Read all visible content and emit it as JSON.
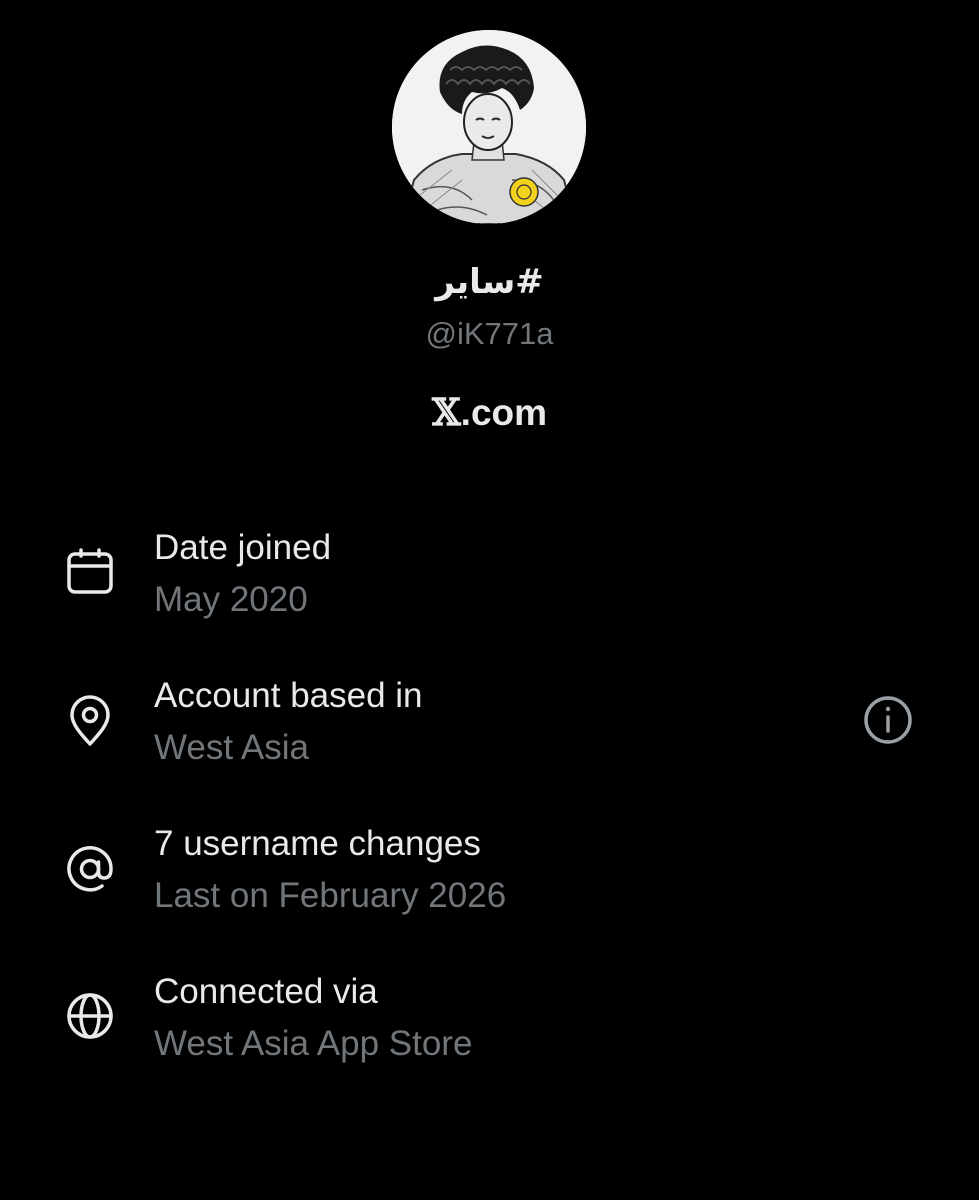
{
  "profile": {
    "display_name": "#ساير",
    "handle": "@iK771a",
    "source_suffix": ".com",
    "source_logo": "𝕏"
  },
  "rows": [
    {
      "icon": "calendar-icon",
      "title": "Date joined",
      "subtitle": "May 2020"
    },
    {
      "icon": "location-pin-icon",
      "title": "Account based in",
      "subtitle": "West Asia",
      "has_info": true
    },
    {
      "icon": "at-sign-icon",
      "title": "7 username changes",
      "subtitle": "Last on February 2026"
    },
    {
      "icon": "globe-icon",
      "title": "Connected via",
      "subtitle": "West Asia App Store"
    }
  ],
  "colors": {
    "background": "#000000",
    "primary_text": "#e7e9ea",
    "secondary_text": "#71767b",
    "avatar_accent": "#f2d21c"
  }
}
